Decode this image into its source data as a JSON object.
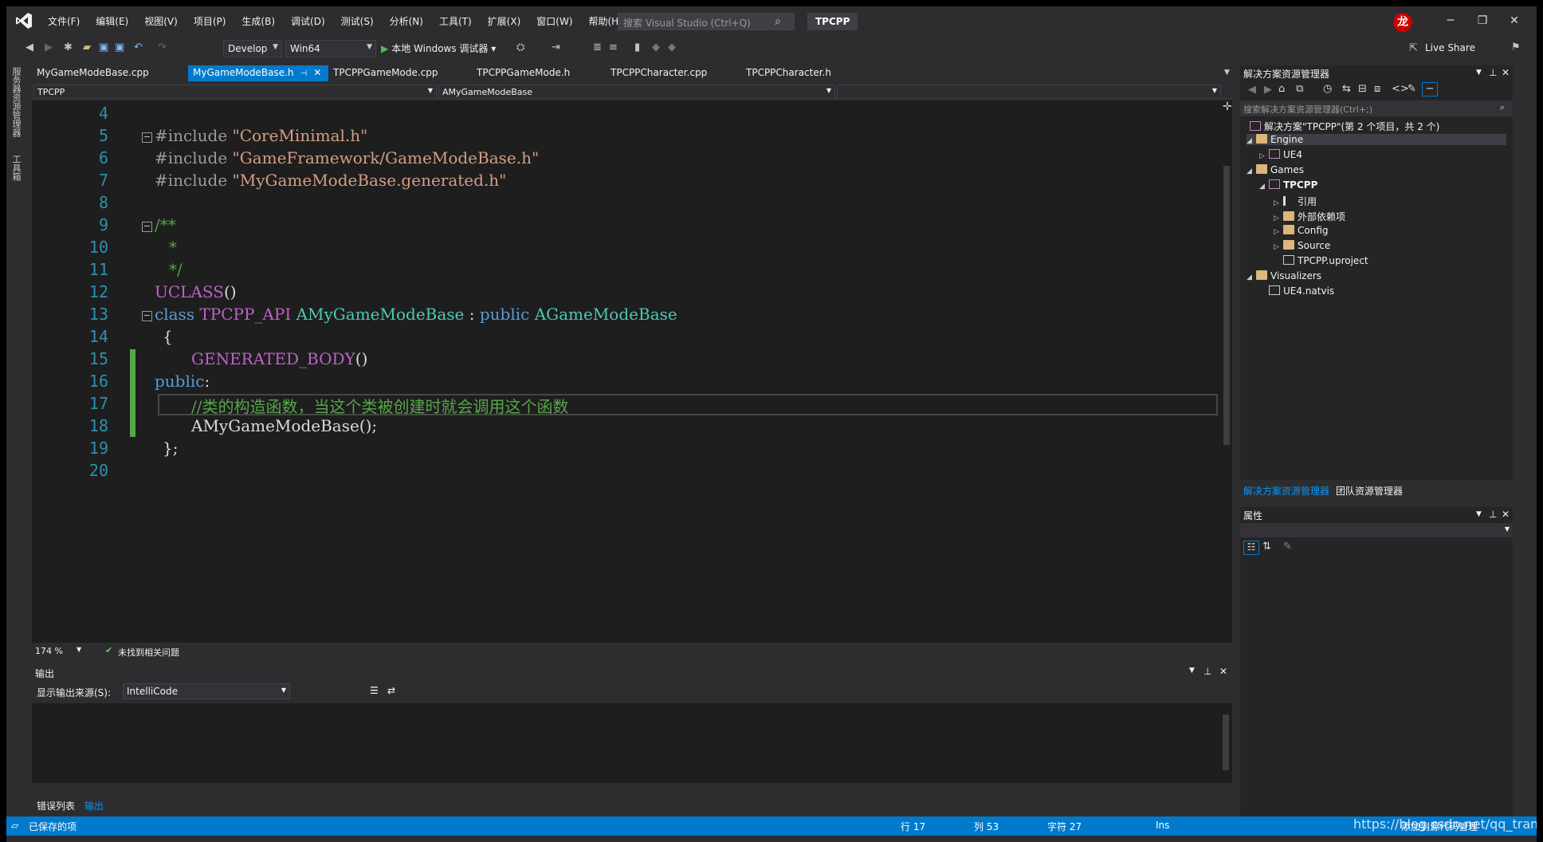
{
  "menu": [
    "文件(F)",
    "编辑(E)",
    "视图(V)",
    "项目(P)",
    "生成(B)",
    "调试(D)",
    "测试(S)",
    "分析(N)",
    "工具(T)",
    "扩展(X)",
    "窗口(W)",
    "帮助(H)"
  ],
  "search": {
    "placeholder": "搜索 Visual Studio (Ctrl+Q)"
  },
  "solution_name": "TPCPP",
  "user_badge": "龙",
  "toolbar": {
    "config": "Develop",
    "platform": "Win64",
    "run_label": "本地 Windows 调试器",
    "live_share": "Live Share"
  },
  "left_strip": [
    "服务器资源管理器",
    "工具箱"
  ],
  "tabs": [
    "MyGameModeBase.cpp",
    "MyGameModeBase.h",
    "TPCPPGameMode.cpp",
    "TPCPPGameMode.h",
    "TPCPPCharacter.cpp",
    "TPCPPCharacter.h"
  ],
  "active_tab": 1,
  "navbar": {
    "project": "TPCPP",
    "scope": "AMyGameModeBase"
  },
  "line_numbers": [
    "4",
    "5",
    "6",
    "7",
    "8",
    "9",
    "10",
    "11",
    "12",
    "13",
    "14",
    "15",
    "16",
    "17",
    "18",
    "19",
    "20"
  ],
  "code": {
    "l5a": "#include ",
    "l5b": "\"CoreMinimal.h\"",
    "l6a": "#include ",
    "l6b": "\"GameFramework/GameModeBase.h\"",
    "l7a": "#include ",
    "l7b": "\"MyGameModeBase.generated.h\"",
    "l9": "/**",
    "l10": "*",
    "l11": "*/",
    "l12a": "UCLASS",
    "l12b": "()",
    "l13a": "class ",
    "l13b": "TPCPP_API ",
    "l13c": "AMyGameModeBase",
    "l13d": " : ",
    "l13e": "public ",
    "l13f": "AGameModeBase",
    "l14": "{",
    "l15a": "GENERATED_BODY",
    "l15b": "()",
    "l16a": "public",
    "l16b": ":",
    "l17": "//类的构造函数，当这个类被创建时就会调用这个函数",
    "l18": "AMyGameModeBase();",
    "l19": "};"
  },
  "editor_status": {
    "zoom": "174 %",
    "issues": "未找到相关问题"
  },
  "output": {
    "title": "输出",
    "source_label": "显示输出来源(S):",
    "source_value": "IntelliCode",
    "tabs": [
      "错误列表",
      "输出"
    ]
  },
  "solution_explorer": {
    "title": "解决方案资源管理器",
    "search_placeholder": "搜索解决方案资源管理器(Ctrl+;)",
    "root": "解决方案\"TPCPP\"(第 2 个项目，共 2 个)",
    "items": [
      "Engine",
      "UE4",
      "Games",
      "TPCPP",
      "引用",
      "外部依赖项",
      "Config",
      "Source",
      "TPCPP.uproject",
      "Visualizers",
      "UE4.natvis"
    ],
    "bottom_tabs": [
      "解决方案资源管理器",
      "团队资源管理器"
    ]
  },
  "properties": {
    "title": "属性"
  },
  "statusbar": {
    "saved": "已保存的项",
    "line": "行 17",
    "col": "列 53",
    "char": "字符 27",
    "mode": "Ins",
    "source_control": "添加到源代码管理",
    "watermark": "https://blog.csdn.net/qq_tramail"
  },
  "colors": {
    "accent": "#007acc",
    "editor_bg": "#1e1e1e",
    "chrome_bg": "#2d2d30",
    "keyword": "#569cd6",
    "string": "#d69d85",
    "comment": "#57a64a",
    "macro": "#bd63c5",
    "line_number": "#2b91af"
  }
}
